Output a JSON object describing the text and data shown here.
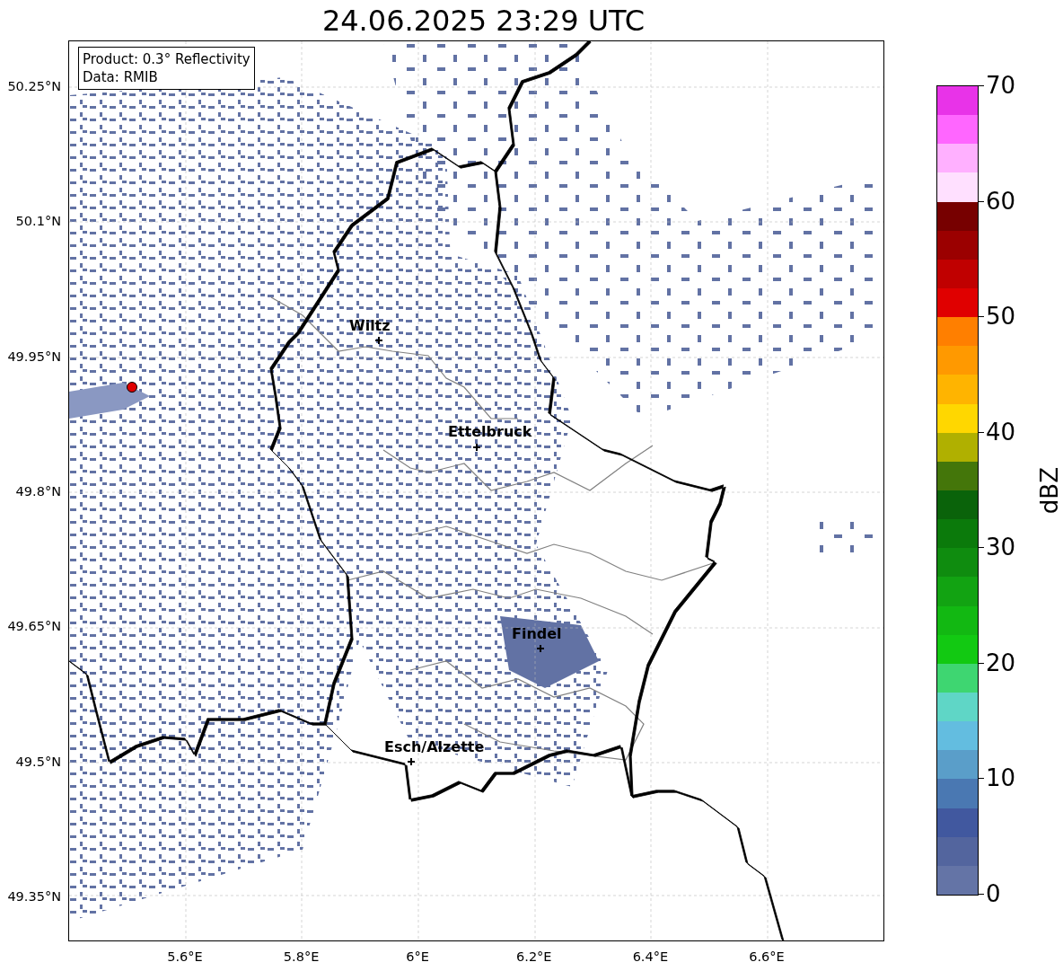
{
  "title": "24.06.2025 23:29 UTC",
  "info_box": [
    "Product: 0.3° Reflectivity",
    "Data: RMIB"
  ],
  "map": {
    "y_ticks": [
      "50.25°N",
      "50.1°N",
      "49.95°N",
      "49.8°N",
      "49.65°N",
      "49.5°N",
      "49.35°N"
    ],
    "x_ticks": [
      "5.6°E",
      "5.8°E",
      "6°E",
      "6.2°E",
      "6.4°E",
      "6.6°E"
    ],
    "cities": [
      "Wiltz",
      "Ettelbruck",
      "Findel",
      "Esch/Alzette"
    ]
  },
  "colorbar": {
    "label": "dBZ",
    "ticks": [
      "70",
      "60",
      "50",
      "40",
      "30",
      "20",
      "10",
      "0"
    ],
    "segments": [
      {
        "color": "#e833e8"
      },
      {
        "color": "#ff66ff"
      },
      {
        "color": "#ffb0ff"
      },
      {
        "color": "#ffe0ff"
      },
      {
        "color": "#770000"
      },
      {
        "color": "#9b0000"
      },
      {
        "color": "#c00000"
      },
      {
        "color": "#e00000"
      },
      {
        "color": "#ff7f00"
      },
      {
        "color": "#ff9900"
      },
      {
        "color": "#ffb400"
      },
      {
        "color": "#ffd700"
      },
      {
        "color": "#b0b000"
      },
      {
        "color": "#44760a"
      },
      {
        "color": "#0a630a"
      },
      {
        "color": "#0b7a0b"
      },
      {
        "color": "#0f8c0f"
      },
      {
        "color": "#12a312"
      },
      {
        "color": "#12b812"
      },
      {
        "color": "#12c912"
      },
      {
        "color": "#3ed671"
      },
      {
        "color": "#5fd6c6"
      },
      {
        "color": "#63bde0"
      },
      {
        "color": "#5a9ec9"
      },
      {
        "color": "#4a78b2"
      },
      {
        "color": "#41589f"
      },
      {
        "color": "#53659e"
      },
      {
        "color": "#6474a6"
      }
    ]
  }
}
